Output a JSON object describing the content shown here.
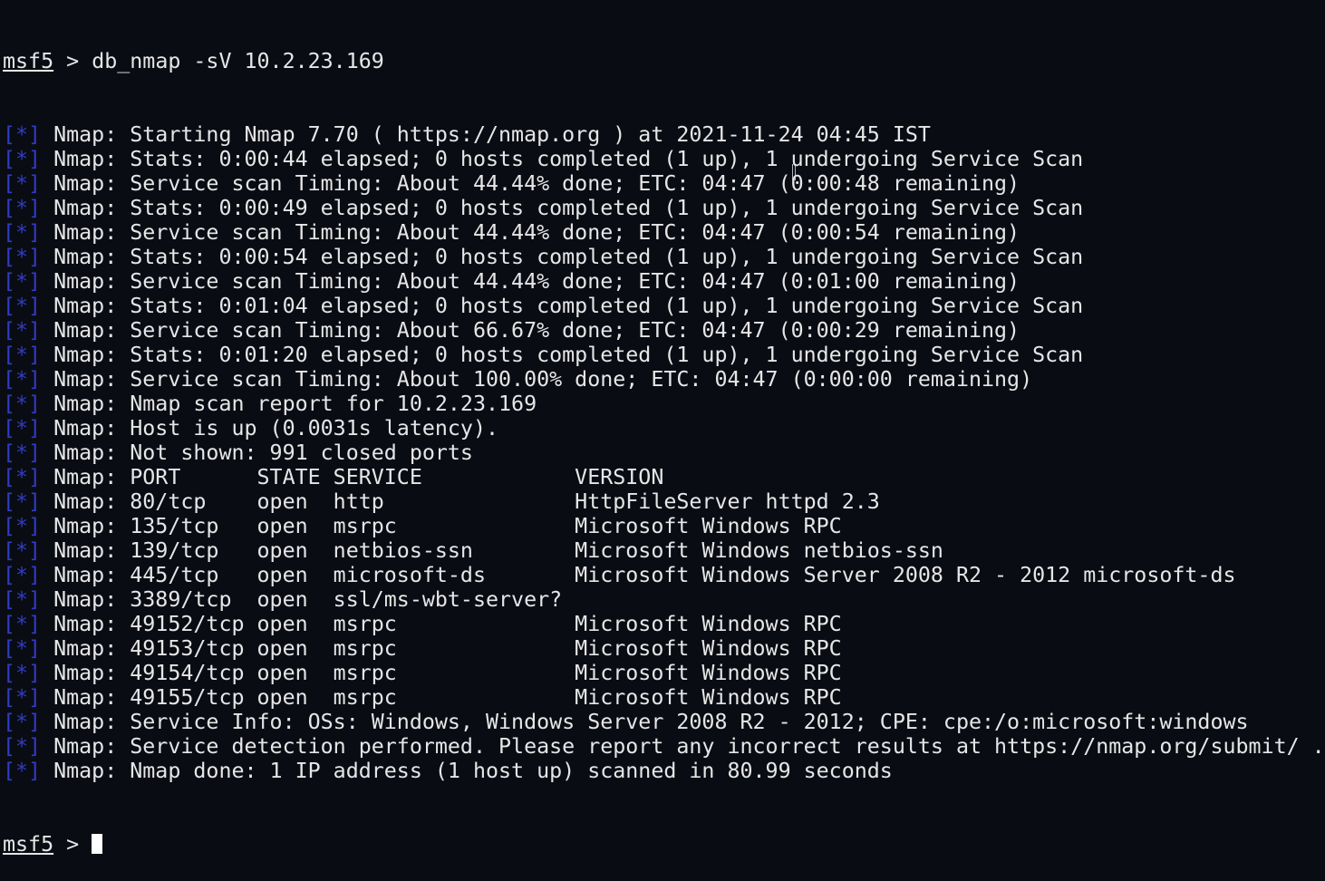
{
  "prompt": {
    "name": "msf5",
    "separator": " > ",
    "command": "db_nmap -sV 10.2.23.169"
  },
  "marker": "[*]",
  "output": [
    " Nmap: Starting Nmap 7.70 ( https://nmap.org ) at 2021-11-24 04:45 IST",
    " Nmap: Stats: 0:00:44 elapsed; 0 hosts completed (1 up), 1 undergoing Service Scan",
    " Nmap: Service scan Timing: About 44.44% done; ETC: 04:47 (0:00:48 remaining)",
    " Nmap: Stats: 0:00:49 elapsed; 0 hosts completed (1 up), 1 undergoing Service Scan",
    " Nmap: Service scan Timing: About 44.44% done; ETC: 04:47 (0:00:54 remaining)",
    " Nmap: Stats: 0:00:54 elapsed; 0 hosts completed (1 up), 1 undergoing Service Scan",
    " Nmap: Service scan Timing: About 44.44% done; ETC: 04:47 (0:01:00 remaining)",
    " Nmap: Stats: 0:01:04 elapsed; 0 hosts completed (1 up), 1 undergoing Service Scan",
    " Nmap: Service scan Timing: About 66.67% done; ETC: 04:47 (0:00:29 remaining)",
    " Nmap: Stats: 0:01:20 elapsed; 0 hosts completed (1 up), 1 undergoing Service Scan",
    " Nmap: Service scan Timing: About 100.00% done; ETC: 04:47 (0:00:00 remaining)",
    " Nmap: Nmap scan report for 10.2.23.169",
    " Nmap: Host is up (0.0031s latency).",
    " Nmap: Not shown: 991 closed ports",
    " Nmap: PORT      STATE SERVICE            VERSION",
    " Nmap: 80/tcp    open  http               HttpFileServer httpd 2.3",
    " Nmap: 135/tcp   open  msrpc              Microsoft Windows RPC",
    " Nmap: 139/tcp   open  netbios-ssn        Microsoft Windows netbios-ssn",
    " Nmap: 445/tcp   open  microsoft-ds       Microsoft Windows Server 2008 R2 - 2012 microsoft-ds",
    " Nmap: 3389/tcp  open  ssl/ms-wbt-server?",
    " Nmap: 49152/tcp open  msrpc              Microsoft Windows RPC",
    " Nmap: 49153/tcp open  msrpc              Microsoft Windows RPC",
    " Nmap: 49154/tcp open  msrpc              Microsoft Windows RPC",
    " Nmap: 49155/tcp open  msrpc              Microsoft Windows RPC",
    " Nmap: Service Info: OSs: Windows, Windows Server 2008 R2 - 2012; CPE: cpe:/o:microsoft:windows",
    " Nmap: Service detection performed. Please report any incorrect results at https://nmap.org/submit/ .",
    " Nmap: Nmap done: 1 IP address (1 host up) scanned in 80.99 seconds"
  ],
  "final_prompt": {
    "name": "msf5",
    "separator": " > "
  },
  "colors": {
    "background": "#0a0c14",
    "text": "#e6e6e6",
    "marker": "#2f3cc6",
    "cursor": "#ffffff"
  }
}
